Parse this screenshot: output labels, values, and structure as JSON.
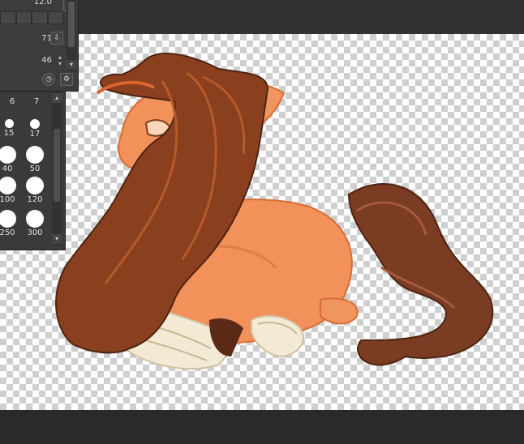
{
  "tool_property": {
    "partial_value": "12.0",
    "density_value": "71",
    "stabilization_value": "46"
  },
  "brush_sizes": [
    "6",
    "7",
    "15",
    "17",
    "40",
    "50",
    "100",
    "120",
    "250",
    "300"
  ],
  "colors": {
    "canvas_bg": "#323232",
    "panel_bg": "#3c3c3c",
    "fur": "#f0915a",
    "mane": "#8a3f1f",
    "bandage": "#f3ead5"
  }
}
